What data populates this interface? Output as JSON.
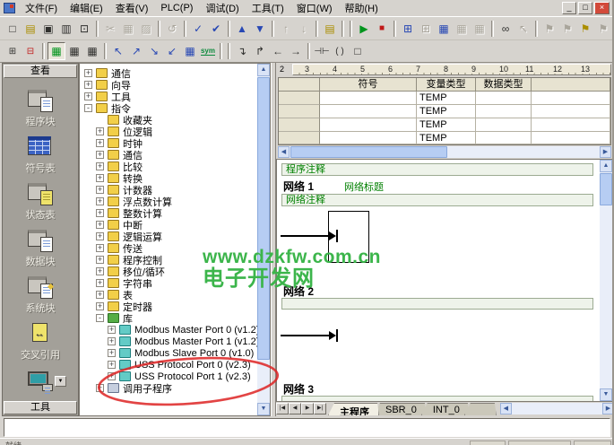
{
  "window": {
    "menus": [
      "文件(F)",
      "编辑(E)",
      "查看(V)",
      "PLC(P)",
      "调试(D)",
      "工具(T)",
      "窗口(W)",
      "帮助(H)"
    ],
    "controls": {
      "minimize": "_",
      "restore": "□",
      "close": "×"
    }
  },
  "toolbar1": {
    "icons": [
      {
        "n": "new-file-icon",
        "g": "□"
      },
      {
        "n": "open-file-icon",
        "g": "▤"
      },
      {
        "n": "save-file-icon",
        "g": "▣"
      },
      {
        "n": "print-icon",
        "g": "▥"
      },
      {
        "n": "print-preview-icon",
        "g": "⊡"
      },
      {
        "n": "cut-icon",
        "g": "✂"
      },
      {
        "n": "copy-icon",
        "g": "▦"
      },
      {
        "n": "paste-icon",
        "g": "▨"
      },
      {
        "n": "undo-icon",
        "g": "↺"
      },
      {
        "n": "compile-icon",
        "g": "✓"
      },
      {
        "n": "compile-all-icon",
        "g": "✔"
      },
      {
        "n": "upload-icon",
        "g": "▲"
      },
      {
        "n": "download-icon",
        "g": "▼"
      },
      {
        "n": "sort-asc-icon",
        "g": "↑"
      },
      {
        "n": "sort-desc-icon",
        "g": "↓"
      },
      {
        "n": "options-icon",
        "g": "▤"
      },
      {
        "n": "run-icon",
        "g": "▶"
      },
      {
        "n": "stop-icon",
        "g": "■"
      },
      {
        "n": "program-status-icon",
        "g": "⊞"
      },
      {
        "n": "program-status-pause-icon",
        "g": "⊞"
      },
      {
        "n": "chart-status-icon",
        "g": "▦"
      },
      {
        "n": "chart-status-pause-icon",
        "g": "▦"
      },
      {
        "n": "chart-read-icon",
        "g": "▦"
      },
      {
        "n": "view-glasses-icon",
        "g": "∞"
      },
      {
        "n": "pointer-icon",
        "g": "↖"
      },
      {
        "n": "bookmark-toggle-icon",
        "g": "⚑"
      },
      {
        "n": "bookmark-next-icon",
        "g": "⚑"
      },
      {
        "n": "bookmark-prev-icon",
        "g": "⚑"
      },
      {
        "n": "bookmark-clear-icon",
        "g": "⚑"
      }
    ]
  },
  "toolbar2": {
    "icons": [
      {
        "n": "insert-network-icon",
        "g": "⊞"
      },
      {
        "n": "delete-network-icon",
        "g": "⊟"
      },
      {
        "n": "view-ladder-icon",
        "g": "▦"
      },
      {
        "n": "view-fbd-icon",
        "g": "▦"
      },
      {
        "n": "view-stl-icon",
        "g": "▦"
      },
      {
        "n": "ladder-tool-1-icon",
        "g": "↖"
      },
      {
        "n": "ladder-tool-2-icon",
        "g": "↗"
      },
      {
        "n": "ladder-tool-3-icon",
        "g": "↘"
      },
      {
        "n": "ladder-tool-4-icon",
        "g": "↙"
      },
      {
        "n": "address-table-icon",
        "g": "▦"
      },
      {
        "n": "symbolic-addressing-icon",
        "g": "sym"
      },
      {
        "n": "line-down-icon",
        "g": "↴"
      },
      {
        "n": "line-up-icon",
        "g": "↱"
      },
      {
        "n": "line-left-icon",
        "g": "←"
      },
      {
        "n": "line-right-icon",
        "g": "→"
      },
      {
        "n": "contact-icon",
        "g": "⊣⊢"
      },
      {
        "n": "coil-icon",
        "g": "( )"
      },
      {
        "n": "box-icon",
        "g": "□"
      }
    ]
  },
  "viewbar": {
    "header": "查看",
    "footer": "工具",
    "items": [
      {
        "label": "程序块"
      },
      {
        "label": "符号表"
      },
      {
        "label": "状态表"
      },
      {
        "label": "数据块"
      },
      {
        "label": "系统块"
      },
      {
        "label": "交叉引用"
      }
    ],
    "comm_drop": "▼"
  },
  "tree": {
    "items": [
      {
        "e": "+",
        "label": "通信"
      },
      {
        "e": "+",
        "label": "向导"
      },
      {
        "e": "+",
        "label": "工具"
      },
      {
        "e": "-",
        "label": "指令"
      },
      {
        "e": "",
        "label": "收藏夹"
      },
      {
        "e": "+",
        "label": "位逻辑"
      },
      {
        "e": "+",
        "label": "时钟"
      },
      {
        "e": "+",
        "label": "通信"
      },
      {
        "e": "+",
        "label": "比较"
      },
      {
        "e": "+",
        "label": "转换"
      },
      {
        "e": "+",
        "label": "计数器"
      },
      {
        "e": "+",
        "label": "浮点数计算"
      },
      {
        "e": "+",
        "label": "整数计算"
      },
      {
        "e": "+",
        "label": "中断"
      },
      {
        "e": "+",
        "label": "逻辑运算"
      },
      {
        "e": "+",
        "label": "传送"
      },
      {
        "e": "+",
        "label": "程序控制"
      },
      {
        "e": "+",
        "label": "移位/循环"
      },
      {
        "e": "+",
        "label": "字符串"
      },
      {
        "e": "+",
        "label": "表"
      },
      {
        "e": "+",
        "label": "定时器"
      },
      {
        "e": "-",
        "label": "库"
      },
      {
        "e": "+",
        "label": "Modbus Master Port 0 (v1.2)"
      },
      {
        "e": "+",
        "label": "Modbus Master Port 1 (v1.2)"
      },
      {
        "e": "+",
        "label": "Modbus Slave Port 0 (v1.0)"
      },
      {
        "e": "+",
        "label": "USS Protocol Port 0 (v2.3)"
      },
      {
        "e": "+",
        "label": "USS Protocol Port 1 (v2.3)"
      },
      {
        "e": "+",
        "label": "调用子程序"
      }
    ]
  },
  "ruler": {
    "labels": [
      "2",
      "3",
      "4",
      "5",
      "6",
      "7",
      "8",
      "9",
      "10",
      "11",
      "12",
      "13"
    ]
  },
  "symbol_table": {
    "headers": [
      "",
      "符号",
      "变量类型",
      "数据类型",
      ""
    ],
    "rows": [
      {
        "symbol": "",
        "vartype": "TEMP",
        "datatype": ""
      },
      {
        "symbol": "",
        "vartype": "TEMP",
        "datatype": ""
      },
      {
        "symbol": "",
        "vartype": "TEMP",
        "datatype": ""
      },
      {
        "symbol": "",
        "vartype": "TEMP",
        "datatype": ""
      }
    ]
  },
  "editor": {
    "program_comment": "程序注释",
    "networks": [
      {
        "label": "网络 1",
        "title": "网络标题",
        "comment": "网络注释"
      },
      {
        "label": "网络 2",
        "comment": ""
      },
      {
        "label": "网络 3",
        "comment": ""
      }
    ]
  },
  "tabs": {
    "nav": [
      "|◀",
      "◀",
      "▶",
      "▶|"
    ],
    "items": [
      "主程序",
      "SBR_0",
      "INT_0"
    ]
  },
  "ui": {
    "up": "▲",
    "down": "▼",
    "left": "◀",
    "right": "▶"
  },
  "statusbar": {
    "ready": "就绪"
  },
  "watermark": {
    "line1": "www.dzkfw.com.cn",
    "line2": "电子开发网",
    "color": "#3cb54b"
  },
  "colors": {
    "ellipse": "#dd2323",
    "run_green": "#00941c",
    "stop_red": "#c01818",
    "watermark_green": "#3cb54b",
    "scrollbar_thumb": "#b6cdf3"
  }
}
